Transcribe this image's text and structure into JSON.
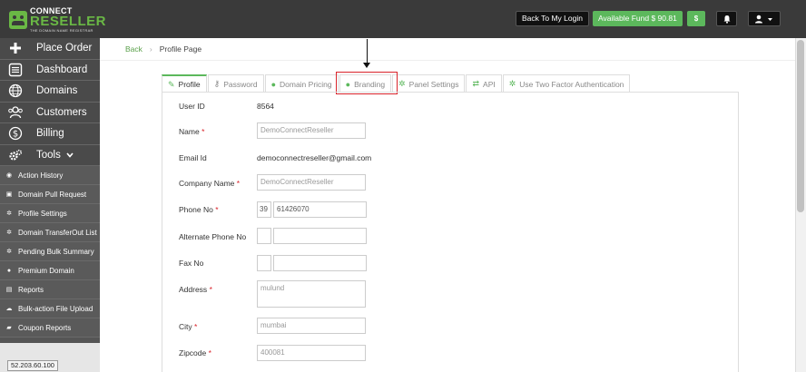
{
  "brand": {
    "line1": "CONNECT",
    "line2": "RESELLER",
    "tagline": "THE DOMAIN NAME REGISTRAR"
  },
  "topbar": {
    "back_login": "Back To My Login",
    "available_fund": "Available Fund  $ 90.81",
    "dollar": "$"
  },
  "sidebar": {
    "main": [
      {
        "label": "Place Order",
        "icon": "plus-icon"
      },
      {
        "label": "Dashboard",
        "icon": "dashboard-icon"
      },
      {
        "label": "Domains",
        "icon": "globe-icon"
      },
      {
        "label": "Customers",
        "icon": "users-icon"
      },
      {
        "label": "Billing",
        "icon": "dollar-circle-icon"
      },
      {
        "label": "Tools",
        "icon": "cogs-icon"
      }
    ],
    "sub": [
      {
        "label": "Action History",
        "icon": "history-icon"
      },
      {
        "label": "Domain Pull Request",
        "icon": "lock-icon"
      },
      {
        "label": "Profile Settings",
        "icon": "cogs-icon"
      },
      {
        "label": "Domain TransferOut List",
        "icon": "cogs-icon"
      },
      {
        "label": "Pending Bulk Summary",
        "icon": "cogs-icon"
      },
      {
        "label": "Premium Domain",
        "icon": "globe-icon"
      },
      {
        "label": "Reports",
        "icon": "image-icon"
      },
      {
        "label": "Bulk-action File Upload",
        "icon": "cloud-upload-icon"
      },
      {
        "label": "Coupon Reports",
        "icon": "ticket-icon"
      }
    ],
    "ip": "52.203.60.100"
  },
  "breadcrumb": {
    "back": "Back",
    "sep": "›",
    "current": "Profile Page"
  },
  "tabs": [
    {
      "label": "Profile",
      "icon": "edit-icon",
      "active": true
    },
    {
      "label": "Password",
      "icon": "key-icon",
      "active": false
    },
    {
      "label": "Domain Pricing",
      "icon": "dollar-icon",
      "active": false
    },
    {
      "label": "Branding",
      "icon": "globe-icon",
      "active": false
    },
    {
      "label": "Panel Settings",
      "icon": "gear-icon",
      "active": false
    },
    {
      "label": "API",
      "icon": "exchange-icon",
      "active": false
    },
    {
      "label": "Use Two Factor Authentication",
      "icon": "gear-icon",
      "active": false
    }
  ],
  "form": {
    "user_id_label": "User ID",
    "user_id_value": "8564",
    "name_label": "Name",
    "name_value": "DemoConnectReseller",
    "email_label": "Email Id",
    "email_value": "democonnectreseller@gmail.com",
    "company_label": "Company Name",
    "company_value": "DemoConnectReseller",
    "phone_label": "Phone No",
    "phone_cc": "39",
    "phone_value": "61426070",
    "alt_phone_label": "Alternate Phone No",
    "fax_label": "Fax No",
    "address_label": "Address",
    "address_value": "mulund",
    "city_label": "City",
    "city_value": "mumbai",
    "zip_label": "Zipcode",
    "zip_value": "400081",
    "required_mark": "*"
  }
}
